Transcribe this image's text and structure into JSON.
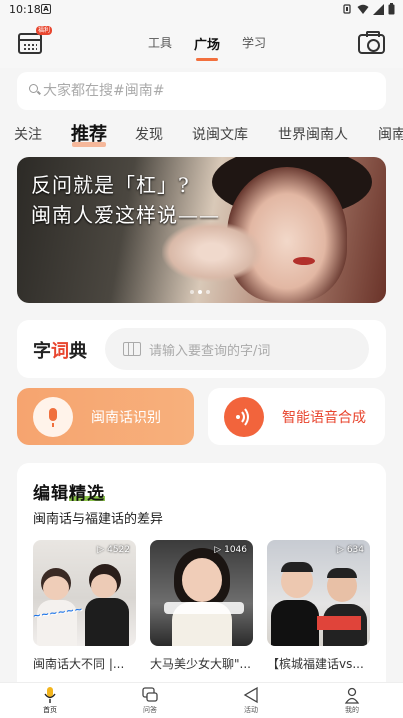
{
  "status_bar": {
    "time": "10:18",
    "notification_glyph": "A"
  },
  "header": {
    "calendar_badge": "福利",
    "tabs": [
      {
        "label": "工具",
        "active": false
      },
      {
        "label": "广场",
        "active": true
      },
      {
        "label": "学习",
        "active": false
      }
    ],
    "accent_color": "#f2703e"
  },
  "search": {
    "placeholder": "大家都在搜#闽南#"
  },
  "channels": [
    {
      "label": "关注",
      "active": false
    },
    {
      "label": "推荐",
      "active": true
    },
    {
      "label": "发现",
      "active": false
    },
    {
      "label": "说闽文库",
      "active": false
    },
    {
      "label": "世界闽南人",
      "active": false
    },
    {
      "label": "闽南",
      "active": false
    }
  ],
  "banner": {
    "line1": "反问就是「杠」?",
    "line2": "闽南人爱这样说——",
    "slide_count": 3,
    "active_slide": 1
  },
  "dictionary": {
    "title_start": "字",
    "title_highlight": "词",
    "title_end": "典",
    "input_placeholder": "请输入要查询的字/词"
  },
  "actions": {
    "recognition_label": "闽南话识别",
    "synthesis_label": "智能语音合成"
  },
  "editor_picks": {
    "heading_a": "编辑",
    "heading_b": "精选",
    "subtitle": "闽南话与福建话的差异",
    "videos": [
      {
        "views": "4522",
        "caption": "闽南话大不同 |..."
      },
      {
        "views": "1046",
        "caption": "大马美少女大聊\"..."
      },
      {
        "views": "634",
        "caption": "【槟城福建话vs..."
      }
    ]
  },
  "bottom_nav": [
    {
      "label": "首页",
      "icon": "mic-icon",
      "active": true
    },
    {
      "label": "问答",
      "icon": "chat-icon",
      "active": false
    },
    {
      "label": "活动",
      "icon": "send-icon",
      "active": false
    },
    {
      "label": "我的",
      "icon": "person-icon",
      "active": false
    }
  ]
}
